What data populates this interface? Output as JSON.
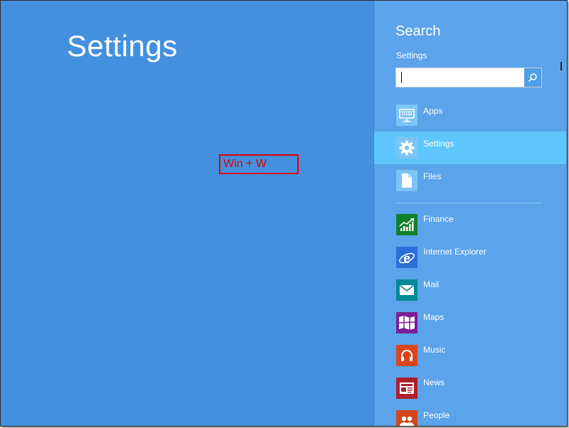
{
  "main": {
    "title": "Settings",
    "annotation": "Win + W"
  },
  "search_pane": {
    "title": "Search",
    "scope": "Settings",
    "search_value": "",
    "scopes": [
      {
        "label": "Apps",
        "icon": "keyboard-icon",
        "tile_color": "#7cc4f6",
        "selected": false
      },
      {
        "label": "Settings",
        "icon": "gear-icon",
        "tile_color": "#7cc4f6",
        "selected": true
      },
      {
        "label": "Files",
        "icon": "file-icon",
        "tile_color": "#7cc4f6",
        "selected": false
      }
    ],
    "apps": [
      {
        "label": "Finance",
        "icon": "chart-icon",
        "tile_color": "#14802d"
      },
      {
        "label": "Internet Explorer",
        "icon": "internet-explorer-icon",
        "tile_color": "#2b6fd9"
      },
      {
        "label": "Mail",
        "icon": "mail-icon",
        "tile_color": "#008a94"
      },
      {
        "label": "Maps",
        "icon": "map-icon",
        "tile_color": "#7b1f96"
      },
      {
        "label": "Music",
        "icon": "headphones-icon",
        "tile_color": "#d8461e"
      },
      {
        "label": "News",
        "icon": "newspaper-icon",
        "tile_color": "#b01f2e"
      },
      {
        "label": "People",
        "icon": "people-icon",
        "tile_color": "#d2461c"
      }
    ]
  },
  "colors": {
    "main_background": "#4490de",
    "pane_background": "#5ba3ea",
    "selected_highlight": "#5ec6fd",
    "annotation": "#e00000"
  }
}
